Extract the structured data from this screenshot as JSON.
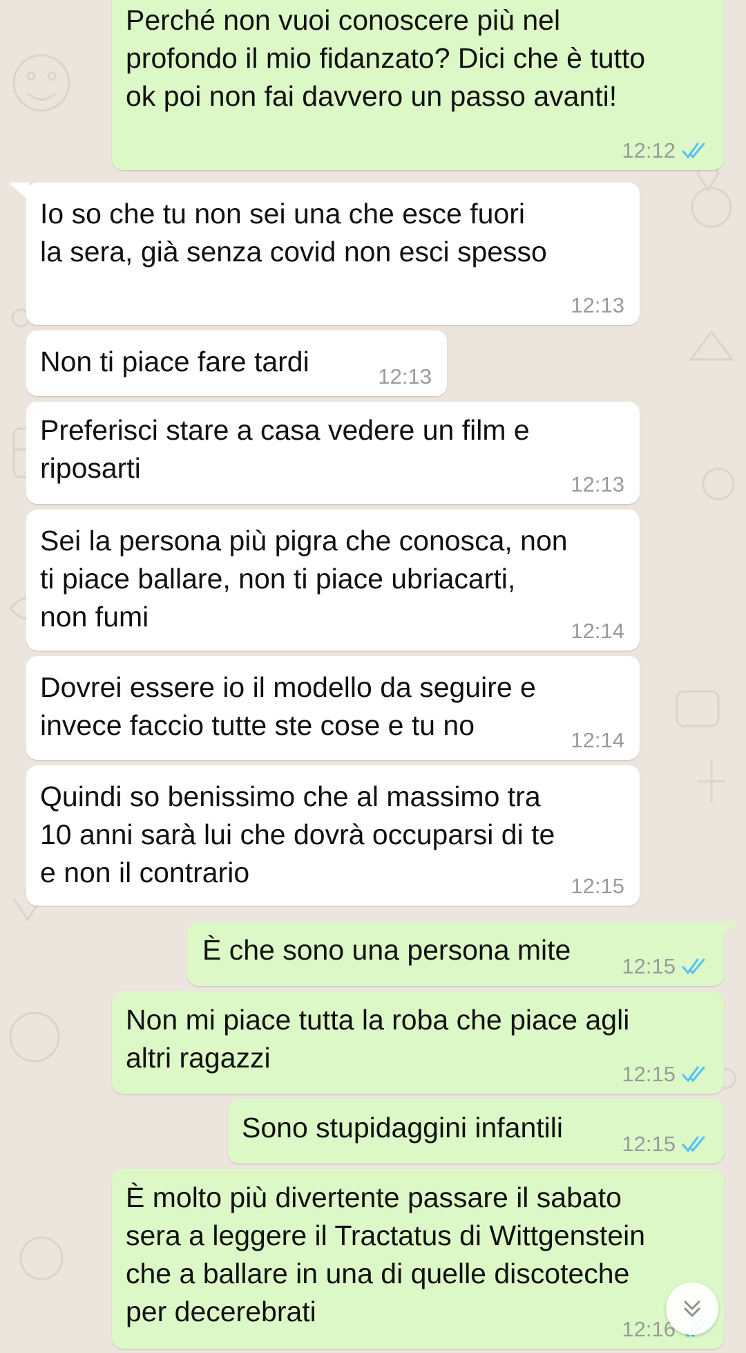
{
  "chat": {
    "messages": [
      {
        "dir": "out",
        "text": "Perché non vuoi conoscere più nel\nprofondo il mio fidanzato? Dici che è tutto\nok poi non fai davvero un passo avanti!",
        "time": "12:12",
        "status": "read"
      },
      {
        "dir": "in",
        "text": "Io so che tu non sei una che esce fuori\nla sera, già senza covid non esci spesso",
        "time": "12:13"
      },
      {
        "dir": "in",
        "text": "Non ti piace fare tardi",
        "time": "12:13"
      },
      {
        "dir": "in",
        "text": "Preferisci stare a casa vedere un film e\nriposarti",
        "time": "12:13"
      },
      {
        "dir": "in",
        "text": "Sei la persona più pigra che conosca, non\nti piace ballare, non ti piace ubriacarti,\nnon fumi",
        "time": "12:14"
      },
      {
        "dir": "in",
        "text": "Dovrei essere io il modello da seguire e\ninvece faccio tutte ste cose e tu no",
        "time": "12:14"
      },
      {
        "dir": "in",
        "text": "Quindi so benissimo che al massimo tra\n10 anni sarà lui che dovrà occuparsi di te\ne non il contrario",
        "time": "12:15"
      },
      {
        "dir": "out",
        "text": "È che sono una persona mite",
        "time": "12:15",
        "status": "read"
      },
      {
        "dir": "out",
        "text": "Non mi piace tutta la roba che piace agli\naltri ragazzi",
        "time": "12:15",
        "status": "read"
      },
      {
        "dir": "out",
        "text": "Sono stupidaggini infantili",
        "time": "12:15",
        "status": "read"
      },
      {
        "dir": "out",
        "text": "È molto più divertente passare il sabato\nsera a leggere il Tractatus di Wittgenstein\nche a ballare in una di quelle discoteche\nper decerebrati",
        "time": "12:16",
        "status": "read"
      }
    ]
  },
  "scroll_button": {
    "icon": "double-chevron-down-icon"
  },
  "colors": {
    "wallpaper": "#ece5dd",
    "outgoing_bubble": "#dcf8c6",
    "incoming_bubble": "#ffffff",
    "timestamp": "#999b9c",
    "read_ticks": "#4fc3f7"
  }
}
